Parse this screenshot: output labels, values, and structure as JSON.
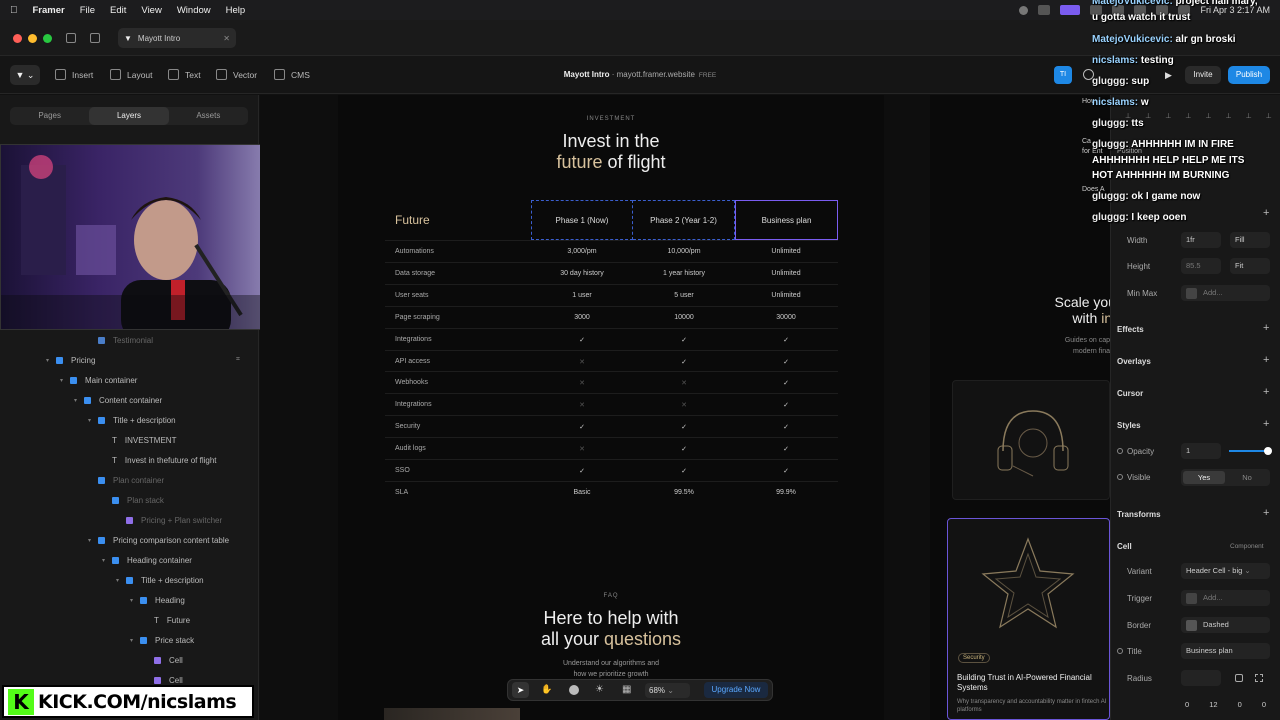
{
  "menubar": {
    "app": "Framer",
    "items": [
      "File",
      "Edit",
      "View",
      "Window",
      "Help"
    ],
    "clock": "Fri Apr 3  2:17 AM"
  },
  "tab": {
    "title": "Mayott Intro"
  },
  "toolbar": {
    "insert": "Insert",
    "layout": "Layout",
    "text": "Text",
    "vector": "Vector",
    "cms": "CMS",
    "site_name": "Mayott Intro",
    "site_url": "mayott.framer.website",
    "plan": "FREE",
    "invite": "Invite",
    "publish": "Publish",
    "avatar": "TI"
  },
  "leftpanel": {
    "tabs": [
      "Pages",
      "Layers",
      "Assets"
    ],
    "layers": [
      {
        "label": "Testimonial",
        "indent": 112,
        "dim": true,
        "color": "#4a7ec9"
      },
      {
        "label": "Pricing",
        "indent": 70,
        "color": "#3b8ff0",
        "arrow": "▾"
      },
      {
        "label": "Main container",
        "indent": 84,
        "color": "#3b8ff0",
        "arrow": "▾"
      },
      {
        "label": "Content container",
        "indent": 98,
        "color": "#3b8ff0",
        "arrow": "▾"
      },
      {
        "label": "Title + description",
        "indent": 112,
        "color": "#3b8ff0",
        "arrow": "▾"
      },
      {
        "label": "INVESTMENT",
        "indent": 126,
        "color": "#aaa",
        "text": true
      },
      {
        "label": "Invest in thefuture of flight",
        "indent": 126,
        "color": "#aaa",
        "text": true
      },
      {
        "label": "Plan container",
        "indent": 112,
        "color": "#3b8ff0",
        "dim": true
      },
      {
        "label": "Plan stack",
        "indent": 126,
        "color": "#3b8ff0",
        "dim": true
      },
      {
        "label": "Pricing + Plan switcher",
        "indent": 140,
        "color": "#8f6fe8",
        "dim": true
      },
      {
        "label": "Pricing comparison content table",
        "indent": 112,
        "color": "#3b8ff0",
        "arrow": "▾"
      },
      {
        "label": "Heading container",
        "indent": 126,
        "color": "#3b8ff0",
        "arrow": "▾"
      },
      {
        "label": "Title + description",
        "indent": 140,
        "color": "#3b8ff0",
        "arrow": "▾"
      },
      {
        "label": "Heading",
        "indent": 154,
        "color": "#3b8ff0",
        "arrow": "▾"
      },
      {
        "label": "Future",
        "indent": 168,
        "color": "#aaa",
        "text": true
      },
      {
        "label": "Price stack",
        "indent": 154,
        "color": "#3b8ff0",
        "arrow": "▾"
      },
      {
        "label": "Cell",
        "indent": 168,
        "color": "#8f6fe8"
      },
      {
        "label": "Cell",
        "indent": 168,
        "color": "#8f6fe8"
      }
    ]
  },
  "page": {
    "eyebrow": "INVESTMENT",
    "title_line1": "Invest in the",
    "title_gold": "future",
    "title_rest": " of flight",
    "table": {
      "heading": "Future",
      "columns": [
        "Phase 1 (Now)",
        "Phase 2 (Year 1-2)",
        "Business plan"
      ],
      "rows": [
        {
          "label": "Automations",
          "values": [
            "3,000/pm",
            "10,000/pm",
            "Unlimited"
          ]
        },
        {
          "label": "Data storage",
          "values": [
            "30 day history",
            "1 year history",
            "Unlimited"
          ]
        },
        {
          "label": "User seats",
          "values": [
            "1 user",
            "5 user",
            "Unlimited"
          ]
        },
        {
          "label": "Page scraping",
          "values": [
            "3000",
            "10000",
            "30000"
          ]
        },
        {
          "label": "Integrations",
          "values": [
            "✓",
            "✓",
            "✓"
          ]
        },
        {
          "label": "API access",
          "values": [
            "✕",
            "✓",
            "✓"
          ]
        },
        {
          "label": "Webhooks",
          "values": [
            "✕",
            "✕",
            "✓"
          ]
        },
        {
          "label": "Integrations",
          "values": [
            "✕",
            "✕",
            "✓"
          ]
        },
        {
          "label": "Security",
          "values": [
            "✓",
            "✓",
            "✓"
          ]
        },
        {
          "label": "Audit logs",
          "values": [
            "✕",
            "✓",
            "✓"
          ]
        },
        {
          "label": "SSO",
          "values": [
            "✓",
            "✓",
            "✓"
          ]
        },
        {
          "label": "SLA",
          "values": [
            "Basic",
            "99.5%",
            "99.9%"
          ]
        }
      ]
    },
    "faq_eyebrow": "FAQ",
    "faq_line1": "Here to help with",
    "faq_line2_plain": "all your ",
    "faq_line2_gold": "questions",
    "faq_sub1": "Understand our algorithms and",
    "faq_sub2": "how we prioritize growth"
  },
  "floatbar": {
    "zoom": "68%",
    "upgrade": "Upgrade Now"
  },
  "rightcanvas": {
    "scale_line1": "Scale you",
    "scale_line2_plain": "with ",
    "scale_line2_gold": "int",
    "scale_sub1": "Guides on cap",
    "scale_sub2": "modern fina",
    "tag": "Security",
    "card_title": "Building Trust in AI-Powered Financial Systems",
    "card_desc": "Why transparency and accountability matter in fintech AI platforms"
  },
  "props": {
    "width_label": "Width",
    "width_value": "1fr",
    "width_mode": "Fill",
    "height_label": "Height",
    "height_value": "85.5",
    "height_mode": "Fit",
    "minmax_label": "Min Max",
    "minmax_add": "Add...",
    "effects": "Effects",
    "overlays": "Overlays",
    "cursor": "Cursor",
    "styles": "Styles",
    "opacity_label": "Opacity",
    "opacity_value": "1",
    "visible_label": "Visible",
    "yes": "Yes",
    "no": "No",
    "transforms": "Transforms",
    "cell": "Cell",
    "component": "Component",
    "variant_label": "Variant",
    "variant_value": "Header Cell - big",
    "trigger_label": "Trigger",
    "trigger_add": "Add...",
    "border_label": "Border",
    "border_value": "Dashed",
    "title_label": "Title",
    "title_value": "Business plan",
    "radius_label": "Radius",
    "padding": [
      "0",
      "12",
      "0",
      "0"
    ],
    "partial": [
      "How",
      "Ca",
      "for Ent",
      "Position",
      "Does A"
    ]
  },
  "chat": [
    {
      "user": "MatejoVukicevic:",
      "msg": " project hail mary, u gotta watch it trust",
      "cls": "u"
    },
    {
      "user": "MatejoVukicevic:",
      "msg": " alr gn broski",
      "cls": "u"
    },
    {
      "user": "nicslams:",
      "msg": " testing",
      "cls": "u"
    },
    {
      "user": "gluggg:",
      "msg": " sup",
      "cls": "g"
    },
    {
      "user": "nicslams:",
      "msg": " w",
      "cls": "u"
    },
    {
      "user": "gluggg:",
      "msg": " tts",
      "cls": "g"
    },
    {
      "user": "gluggg:",
      "msg": " AHHHHHH IM IN FIRE AHHHHHHH HELP HELP ME ITS HOT AHHHHHH IM BURNING",
      "cls": "g"
    },
    {
      "user": "gluggg:",
      "msg": " ok I game now",
      "cls": "g"
    },
    {
      "user": "gluggg:",
      "msg": " I keep ooen",
      "cls": "g"
    }
  ],
  "overlay": {
    "kick": "KICK.COM/nicslams"
  }
}
